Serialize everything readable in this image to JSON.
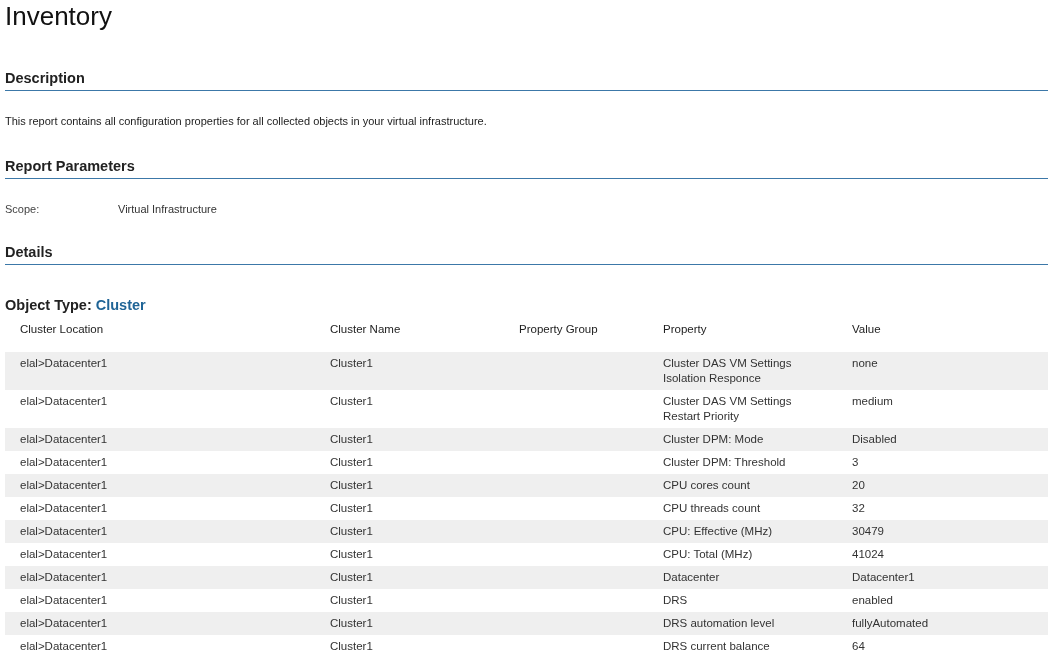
{
  "title": "Inventory",
  "description": {
    "heading": "Description",
    "text": "This report contains all configuration properties for all collected objects in your virtual infrastructure."
  },
  "report_parameters": {
    "heading": "Report Parameters",
    "items": [
      {
        "label": "Scope:",
        "value": "Virtual Infrastructure"
      }
    ]
  },
  "details": {
    "heading": "Details",
    "object_type_label": "Object Type:",
    "object_type": "Cluster"
  },
  "table": {
    "columns": [
      "Cluster Location",
      "Cluster Name",
      "Property Group",
      "Property",
      "Value"
    ],
    "rows": [
      [
        "elal>Datacenter1",
        "Cluster1",
        "",
        "Cluster DAS VM Settings Isolation Responce",
        "none"
      ],
      [
        "elal>Datacenter1",
        "Cluster1",
        "",
        "Cluster DAS VM Settings Restart Priority",
        "medium"
      ],
      [
        "elal>Datacenter1",
        "Cluster1",
        "",
        "Cluster DPM: Mode",
        "Disabled"
      ],
      [
        "elal>Datacenter1",
        "Cluster1",
        "",
        "Cluster DPM: Threshold",
        "3"
      ],
      [
        "elal>Datacenter1",
        "Cluster1",
        "",
        "CPU cores count",
        "20"
      ],
      [
        "elal>Datacenter1",
        "Cluster1",
        "",
        "CPU threads count",
        "32"
      ],
      [
        "elal>Datacenter1",
        "Cluster1",
        "",
        "CPU: Effective (MHz)",
        "30479"
      ],
      [
        "elal>Datacenter1",
        "Cluster1",
        "",
        "CPU: Total (MHz)",
        "41024"
      ],
      [
        "elal>Datacenter1",
        "Cluster1",
        "",
        "Datacenter",
        "Datacenter1"
      ],
      [
        "elal>Datacenter1",
        "Cluster1",
        "",
        "DRS",
        "enabled"
      ],
      [
        "elal>Datacenter1",
        "Cluster1",
        "",
        "DRS automation level",
        "fullyAutomated"
      ],
      [
        "elal>Datacenter1",
        "Cluster1",
        "",
        "DRS current balance",
        "64"
      ]
    ]
  }
}
